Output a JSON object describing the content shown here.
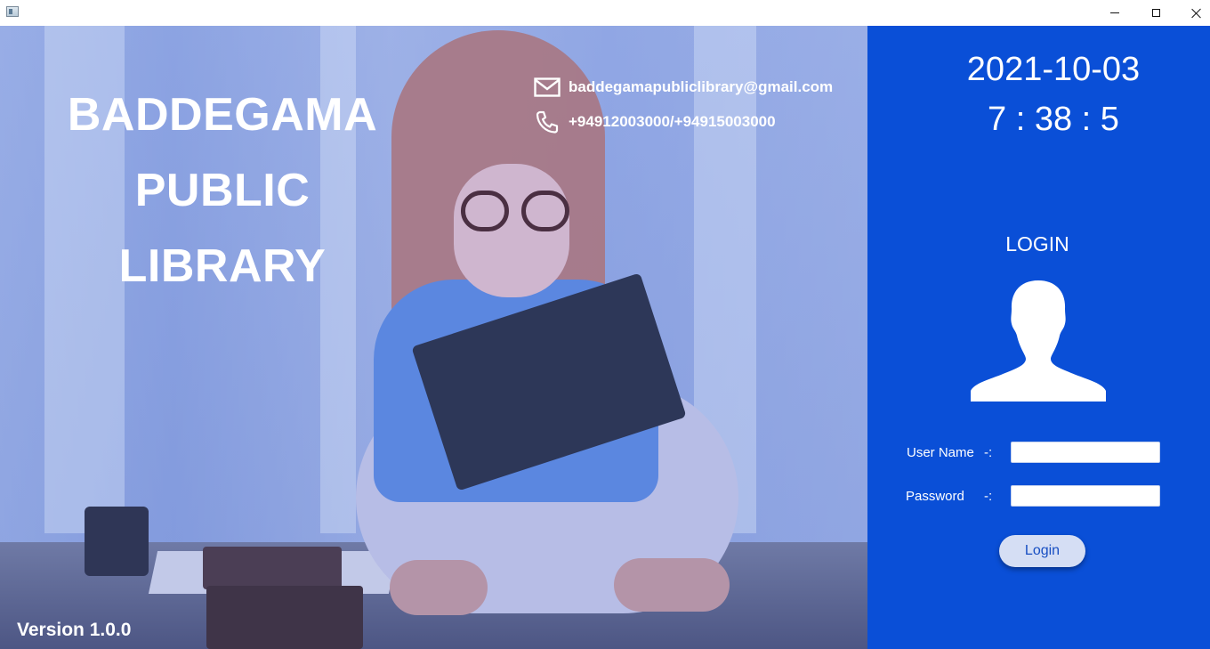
{
  "window": {
    "icon": "app-window-icon",
    "controls": {
      "minimize": "minimize",
      "maximize": "maximize",
      "close": "close"
    }
  },
  "hero": {
    "title_lines": [
      "BADDEGAMA",
      "PUBLIC",
      "LIBRARY"
    ],
    "email": "baddegamapubliclibrary@gmail.com",
    "phone": "+94912003000/+94915003000",
    "version": "Version 1.0.0"
  },
  "panel": {
    "date": "2021-10-03",
    "time": "7 : 38 : 5",
    "login_heading": "LOGIN",
    "username_label": "User Name",
    "username_sep": "-:",
    "username_value": "",
    "password_label": "Password",
    "password_sep": "-:",
    "password_value": "",
    "login_button": "Login"
  },
  "colors": {
    "panel_bg": "#0a4fd7",
    "button_bg": "#d5def4",
    "button_text": "#174ec2"
  }
}
